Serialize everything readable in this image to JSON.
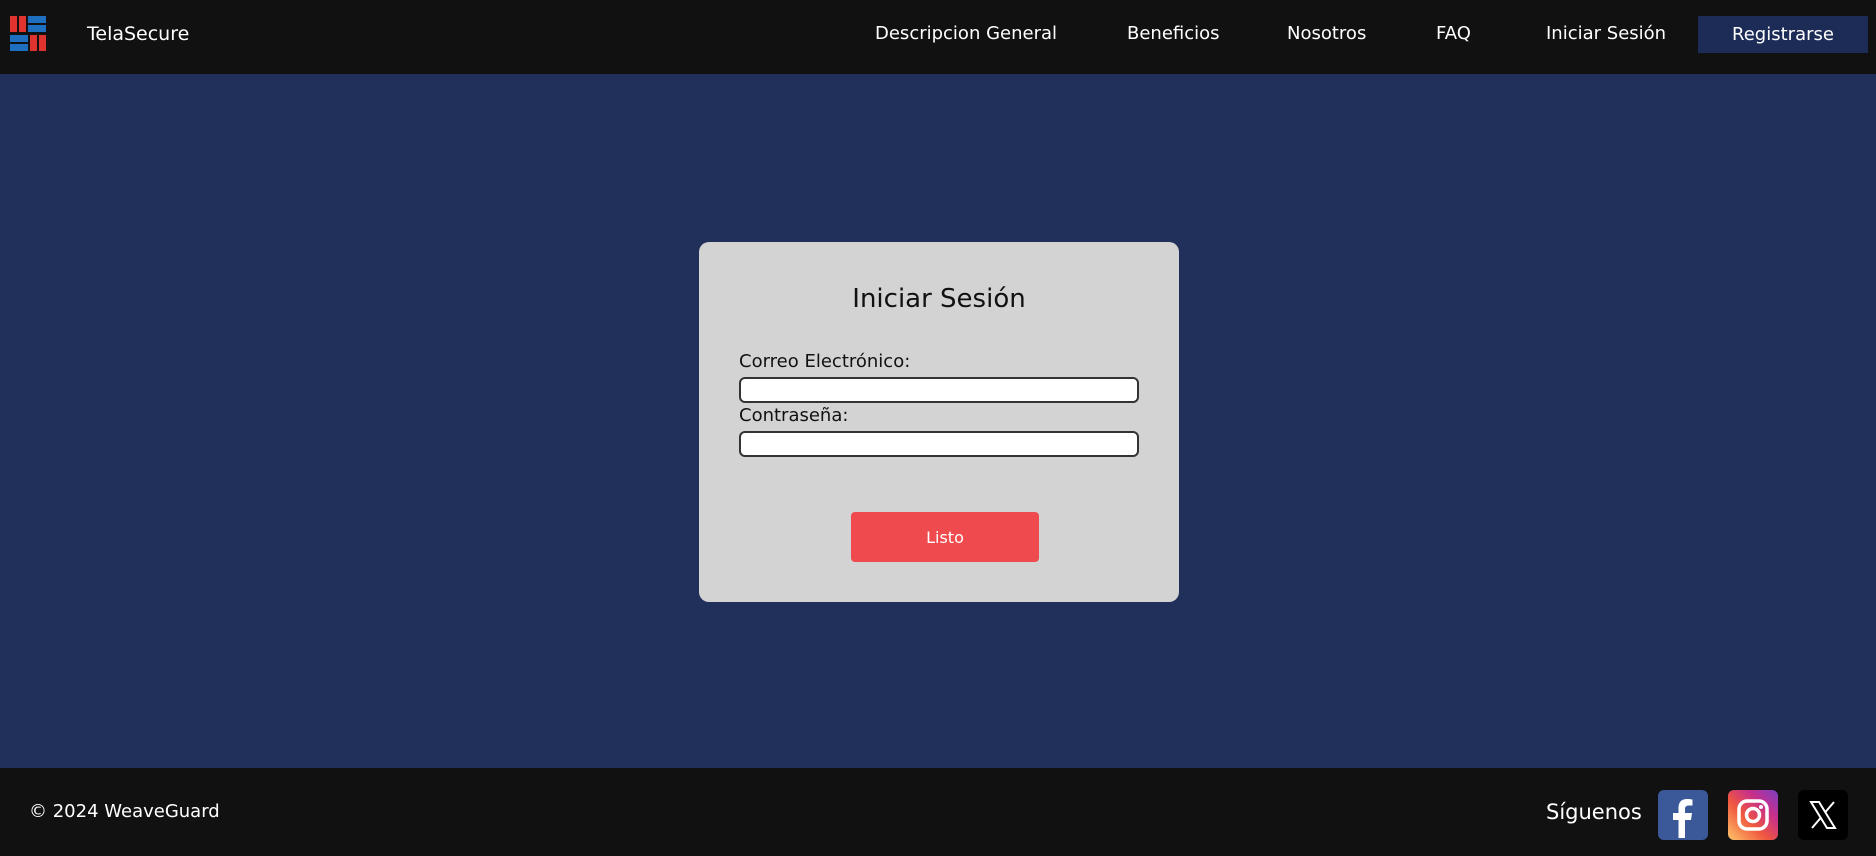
{
  "header": {
    "brand": "TelaSecure",
    "nav": [
      {
        "label": "Descripcion General"
      },
      {
        "label": "Beneficios"
      },
      {
        "label": "Nosotros"
      },
      {
        "label": "FAQ"
      },
      {
        "label": "Iniciar Sesión"
      }
    ],
    "register_label": "Registrarse"
  },
  "login": {
    "title": "Iniciar Sesión",
    "email_label": "Correo Electrónico:",
    "email_value": "",
    "password_label": "Contraseña:",
    "password_value": "",
    "submit_label": "Listo"
  },
  "footer": {
    "copyright": "© 2024 WeaveGuard",
    "follow_label": "Síguenos",
    "social": [
      {
        "icon": "facebook-icon"
      },
      {
        "icon": "instagram-icon"
      },
      {
        "icon": "x-icon"
      }
    ]
  },
  "colors": {
    "header_bg": "#111111",
    "page_bg": "#21305a",
    "card_bg": "#d3d3d3",
    "accent": "#ef4b4e",
    "register_bg": "#1d2c57"
  }
}
